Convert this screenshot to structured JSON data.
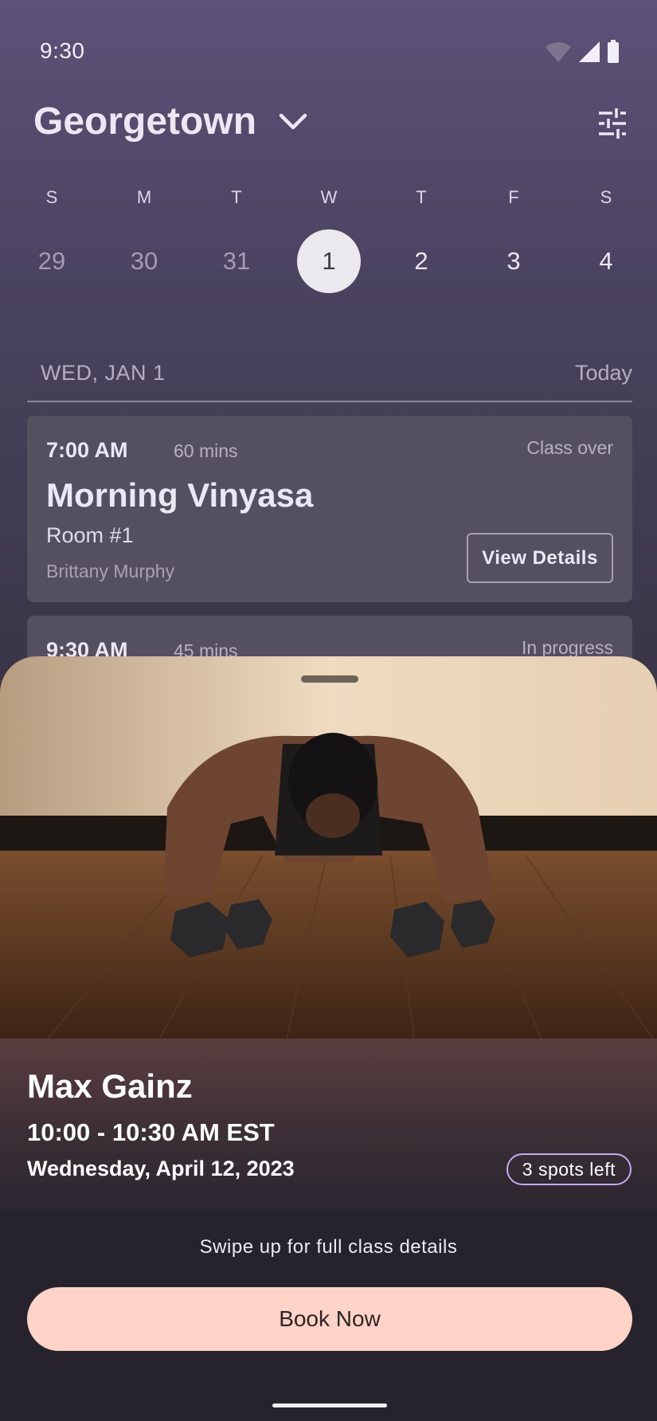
{
  "status_bar": {
    "time": "9:30"
  },
  "header": {
    "location": "Georgetown"
  },
  "calendar": {
    "weekdays": [
      "S",
      "M",
      "T",
      "W",
      "T",
      "F",
      "S"
    ],
    "dates": [
      "29",
      "30",
      "31",
      "1",
      "2",
      "3",
      "4"
    ],
    "selected_date": "1"
  },
  "schedule": {
    "day_label": "WED, JAN 1",
    "today_label": "Today",
    "classes": [
      {
        "time": "7:00 AM",
        "duration": "60 mins",
        "status": "Class over",
        "title": "Morning Vinyasa",
        "room": "Room #1",
        "instructor": "Brittany Murphy",
        "button": "View Details"
      },
      {
        "time": "9:30 AM",
        "duration": "45 mins",
        "status": "In progress"
      }
    ]
  },
  "sheet": {
    "name": "Max Gainz",
    "time_range": "10:00 - 10:30 AM EST",
    "date": "Wednesday, April 12, 2023",
    "spots": "3 spots left",
    "swipe_hint": "Swipe up for full class details",
    "book_button": "Book Now"
  },
  "colors": {
    "accent_button": "#ffd3c7",
    "badge_border": "#c7a8f5",
    "card_background": "#55505f"
  }
}
